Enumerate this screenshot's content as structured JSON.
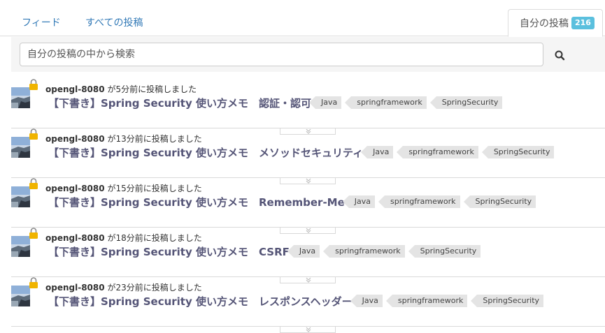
{
  "tabs": {
    "feed": "フィード",
    "all": "すべての投稿",
    "mine": "自分の投稿",
    "mine_count": "216"
  },
  "search": {
    "placeholder": "自分の投稿の中から検索",
    "icon": "search-icon"
  },
  "posts": [
    {
      "user": "opengl-8080",
      "time_text": "が5分前に投稿しました",
      "title": "【下書き】Spring Security 使い方メモ　認証・認可",
      "tags": [
        "Java",
        "springframework",
        "SpringSecurity"
      ]
    },
    {
      "user": "opengl-8080",
      "time_text": "が13分前に投稿しました",
      "title": "【下書き】Spring Security 使い方メモ　メソッドセキュリティ",
      "tags": [
        "Java",
        "springframework",
        "SpringSecurity"
      ]
    },
    {
      "user": "opengl-8080",
      "time_text": "が15分前に投稿しました",
      "title": "【下書き】Spring Security 使い方メモ　Remember-Me",
      "tags": [
        "Java",
        "springframework",
        "SpringSecurity"
      ]
    },
    {
      "user": "opengl-8080",
      "time_text": "が18分前に投稿しました",
      "title": "【下書き】Spring Security 使い方メモ　CSRF",
      "tags": [
        "Java",
        "springframework",
        "SpringSecurity"
      ]
    },
    {
      "user": "opengl-8080",
      "time_text": "が23分前に投稿しました",
      "title": "【下書き】Spring Security 使い方メモ　レスポンスヘッダー",
      "tags": [
        "Java",
        "springframework",
        "SpringSecurity"
      ]
    }
  ],
  "colors": {
    "link": "#337ab7",
    "badge": "#5bc0de",
    "title": "#555577",
    "tag_bg": "#e4e4e4",
    "lock": "#f0b400"
  }
}
